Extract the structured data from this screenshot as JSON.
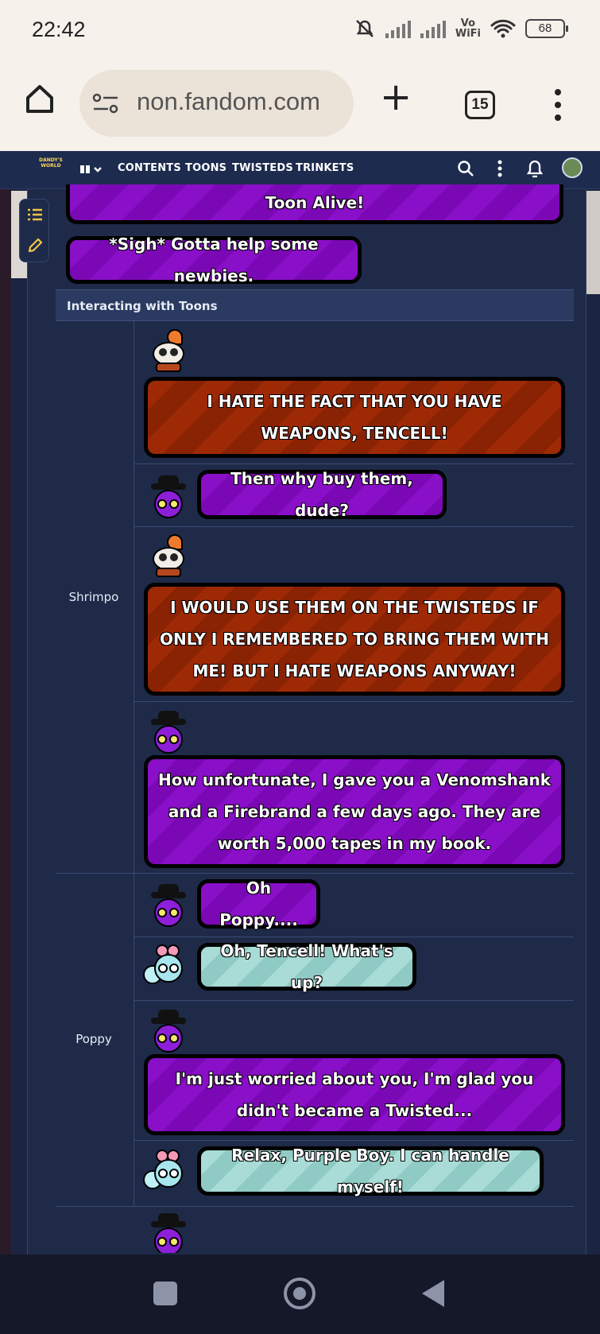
{
  "status_bar": {
    "time": "22:42",
    "network_label": "Vo\nWiFi",
    "battery": "68",
    "icons": [
      "mute-bell-icon",
      "signal-icon",
      "signal-icon",
      "wifi-icon",
      "battery-icon"
    ]
  },
  "browser": {
    "url": "non.fandom.com",
    "tab_count": "15",
    "icons": [
      "home-icon",
      "site-settings-icon",
      "new-tab-icon",
      "tabs-icon",
      "more-menu-icon"
    ]
  },
  "site_nav": {
    "logo_text": "DANDY'S\nWORLD",
    "items": [
      "CONTENTS",
      "TOONS",
      "TWISTEDS",
      "TRINKETS"
    ],
    "icons": [
      "wiki-menu-icon",
      "search-icon",
      "more-icon",
      "notification-bell-icon",
      "user-avatar"
    ]
  },
  "top_bubbles": {
    "toon_alive": "Toon Alive!",
    "newbies": "*Sigh* Gotta help some newbies."
  },
  "section": {
    "title": "Interacting with Toons"
  },
  "conversations": [
    {
      "name": "Shrimpo",
      "lines": [
        {
          "speaker": "Shrimpo",
          "text": "I HATE THE FACT THAT YOU HAVE WEAPONS, TENCELL!"
        },
        {
          "speaker": "Tencell",
          "text": "Then why buy them, dude?"
        },
        {
          "speaker": "Shrimpo",
          "text": "I WOULD USE THEM ON THE TWISTEDS IF ONLY I REMEMBERED TO BRING THEM WITH ME! BUT I HATE WEAPONS ANYWAY!"
        },
        {
          "speaker": "Tencell",
          "text": "How unfortunate, I gave you a Venomshank and a Firebrand a few days ago. They are worth 5,000 tapes in my book."
        }
      ]
    },
    {
      "name": "Poppy",
      "lines": [
        {
          "speaker": "Tencell",
          "text": "Oh Poppy...."
        },
        {
          "speaker": "Poppy",
          "text": "Oh, Tencell! What's up?"
        },
        {
          "speaker": "Tencell",
          "text": "I'm just worried about you, I'm glad you didn't became a Twisted..."
        },
        {
          "speaker": "Poppy",
          "text": "Relax, Purple Boy. I can handle myself!"
        }
      ]
    }
  ],
  "colors": {
    "tencell_bubble": "#8a0fc8",
    "shrimpo_bubble": "#9e2a05",
    "poppy_bubble": "#a9dcd6",
    "page_background": "#1e2a48"
  },
  "android_nav": {
    "icons": [
      "recent-apps-icon",
      "home-circle-icon",
      "back-icon"
    ]
  }
}
